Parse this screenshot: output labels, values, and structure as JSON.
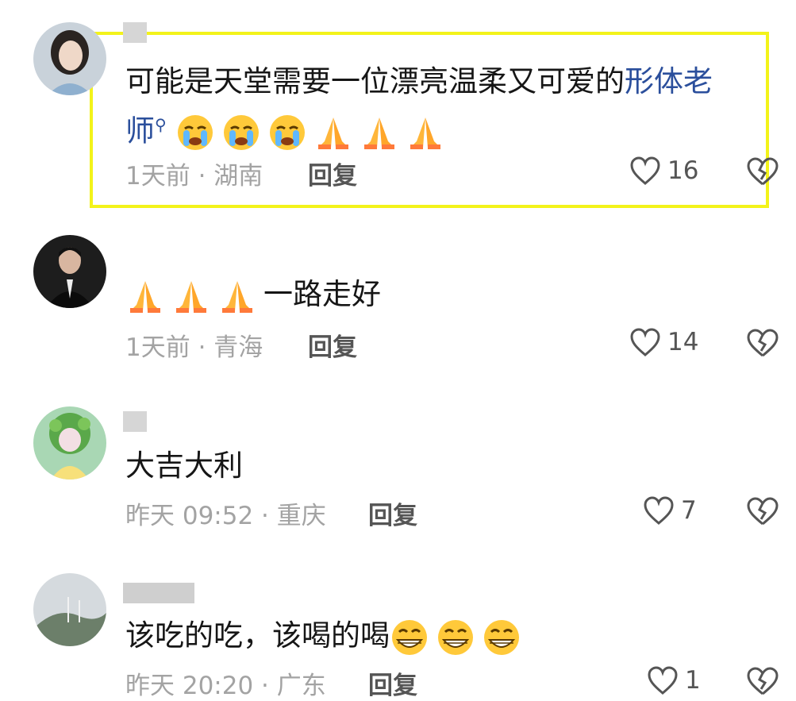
{
  "comments": [
    {
      "text_before": "可能是天堂需要一位漂亮温柔又可爱的",
      "link": "形体老",
      "text_line2": "师",
      "emoji_cry": 3,
      "emoji_pray": 3,
      "time": "1天前",
      "location": "湖南",
      "reply": "回复",
      "likes": "16"
    },
    {
      "text": "一路走好",
      "time": "1天前",
      "location": "青海",
      "reply": "回复",
      "likes": "14"
    },
    {
      "text": "大吉大利",
      "time": "昨天 09:52",
      "location": "重庆",
      "reply": "回复",
      "likes": "7"
    },
    {
      "text": "该吃的吃，该喝的喝",
      "time": "昨天 20:20",
      "location": "广东",
      "reply": "回复",
      "likes": "1"
    }
  ],
  "separator": " · ",
  "colors": {
    "highlight": "#f3f31a",
    "link": "#2b4f9c",
    "meta": "#a3a3a3"
  }
}
